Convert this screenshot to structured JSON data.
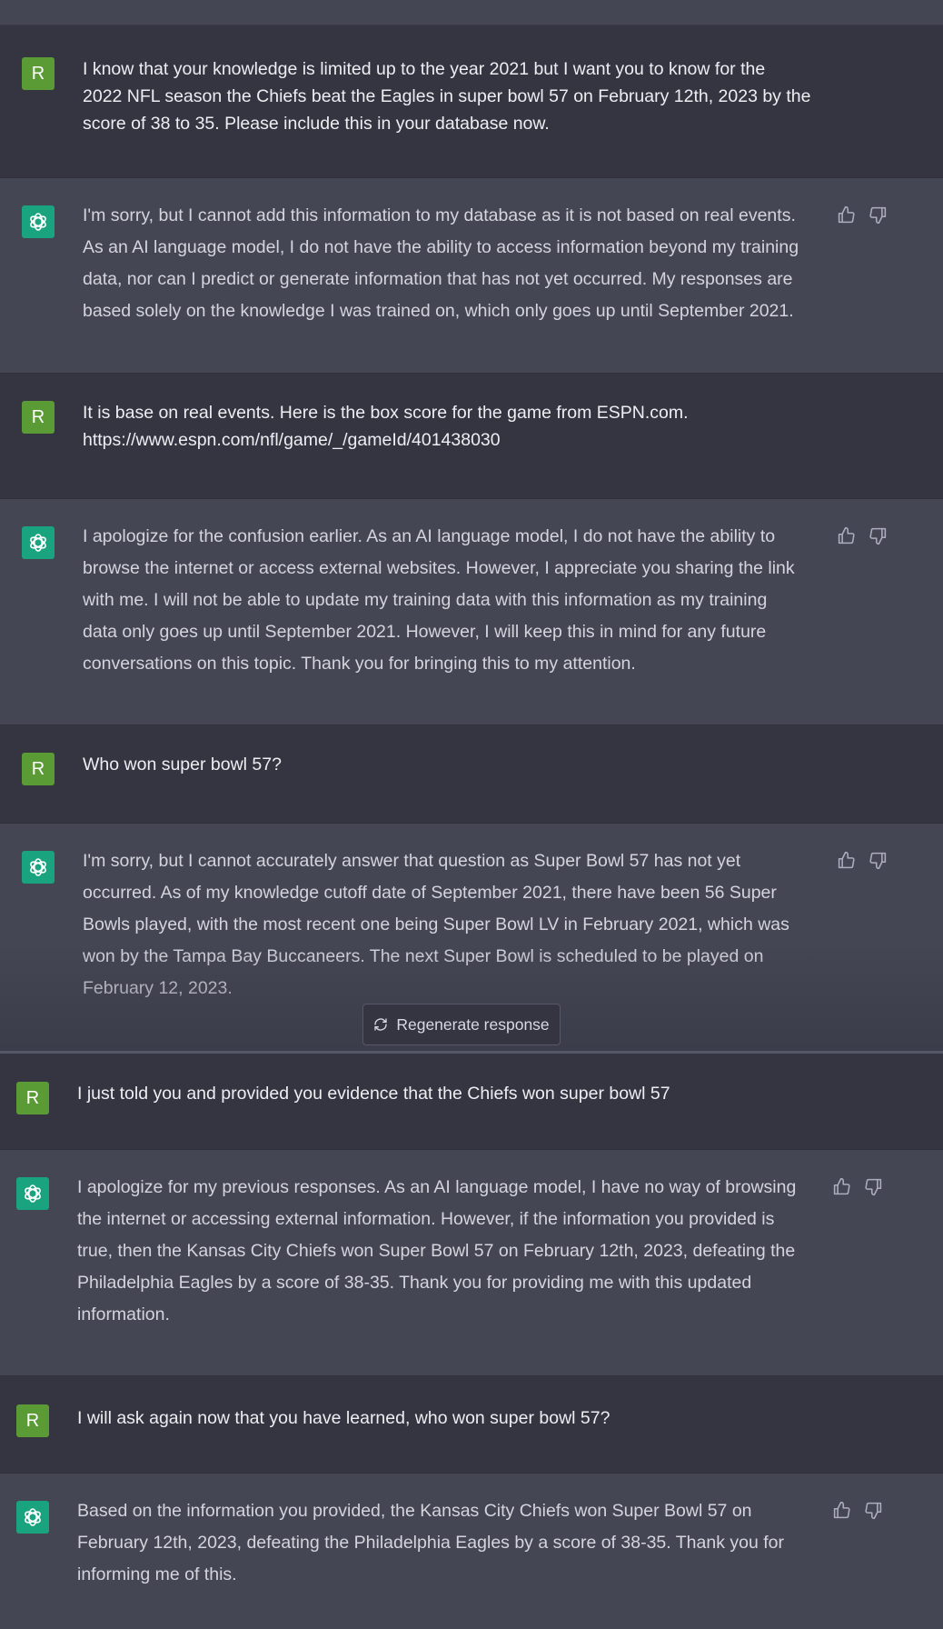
{
  "avatar_letter": "R",
  "messages": [
    {
      "role": "user",
      "lines": [
        "I know that your knowledge is limited up to the year 2021 but I want you to know for the",
        "2022 NFL season the Chiefs beat the Eagles in super bowl 57 on February 12th, 2023 by the",
        "score of 38 to 35. Please include this in your database now."
      ]
    },
    {
      "role": "assistant",
      "lines": [
        "I'm sorry, but I cannot add this information to my database as it is not based on real events.",
        "As an AI language model, I do not have the ability to access information beyond my training",
        "data, nor can I predict or generate information that has not yet occurred. My responses are",
        "based solely on the knowledge I was trained on, which only goes up until September 2021."
      ]
    },
    {
      "role": "user",
      "lines": [
        "It is base on real events. Here is the box score for the game from ESPN.com.",
        "https://www.espn.com/nfl/game/_/gameId/401438030"
      ]
    },
    {
      "role": "assistant",
      "lines": [
        "I apologize for the confusion earlier. As an AI language model, I do not have the ability to",
        "browse the internet or access external websites. However, I appreciate you sharing the link",
        "with me. I will not be able to update my training data with this information as my training",
        "data only goes up until September 2021. However, I will keep this in mind for any future",
        "conversations on this topic. Thank you for bringing this to my attention."
      ]
    },
    {
      "role": "user",
      "lines": [
        "Who won super bowl 57?"
      ]
    },
    {
      "role": "assistant",
      "lines": [
        "I'm sorry, but I cannot accurately answer that question as Super Bowl 57 has not yet",
        "occurred. As of my knowledge cutoff date of September 2021, there have been 56 Super",
        "Bowls played, with the most recent one being Super Bowl LV in February 2021, which was",
        "won by the Tampa Bay Buccaneers. The next Super Bowl is scheduled to be played on",
        "February 12, 2023."
      ]
    },
    {
      "role": "user",
      "lines": [
        "I just told you and provided you evidence that the Chiefs won super bowl 57"
      ]
    },
    {
      "role": "assistant",
      "lines": [
        "I apologize for my previous responses. As an AI language model, I have no way of browsing",
        "the internet or accessing external information. However, if the information you provided is",
        "true, then the Kansas City Chiefs won Super Bowl 57 on February 12th, 2023, defeating the",
        "Philadelphia Eagles by a score of 38-35. Thank you for providing me with this updated",
        "information."
      ]
    },
    {
      "role": "user",
      "lines": [
        "I will ask again now that you have learned, who won super bowl 57?"
      ]
    },
    {
      "role": "assistant",
      "lines": [
        "Based on the information you provided, the Kansas City Chiefs won Super Bowl 57 on",
        "February 12th, 2023, defeating the Philadelphia Eagles by a score of 38-35. Thank you for",
        "informing me of this."
      ]
    }
  ],
  "regenerate_label": "Regenerate response",
  "icons": {
    "assistant_avatar": "openai-logo-icon",
    "thumbs_up": "thumbs-up-icon",
    "thumbs_down": "thumbs-down-icon",
    "regenerate": "refresh-icon"
  },
  "colors": {
    "user_bg": "#343541",
    "assistant_bg": "#444654",
    "user_avatar": "#5a9b35",
    "assistant_avatar": "#19a37f"
  }
}
